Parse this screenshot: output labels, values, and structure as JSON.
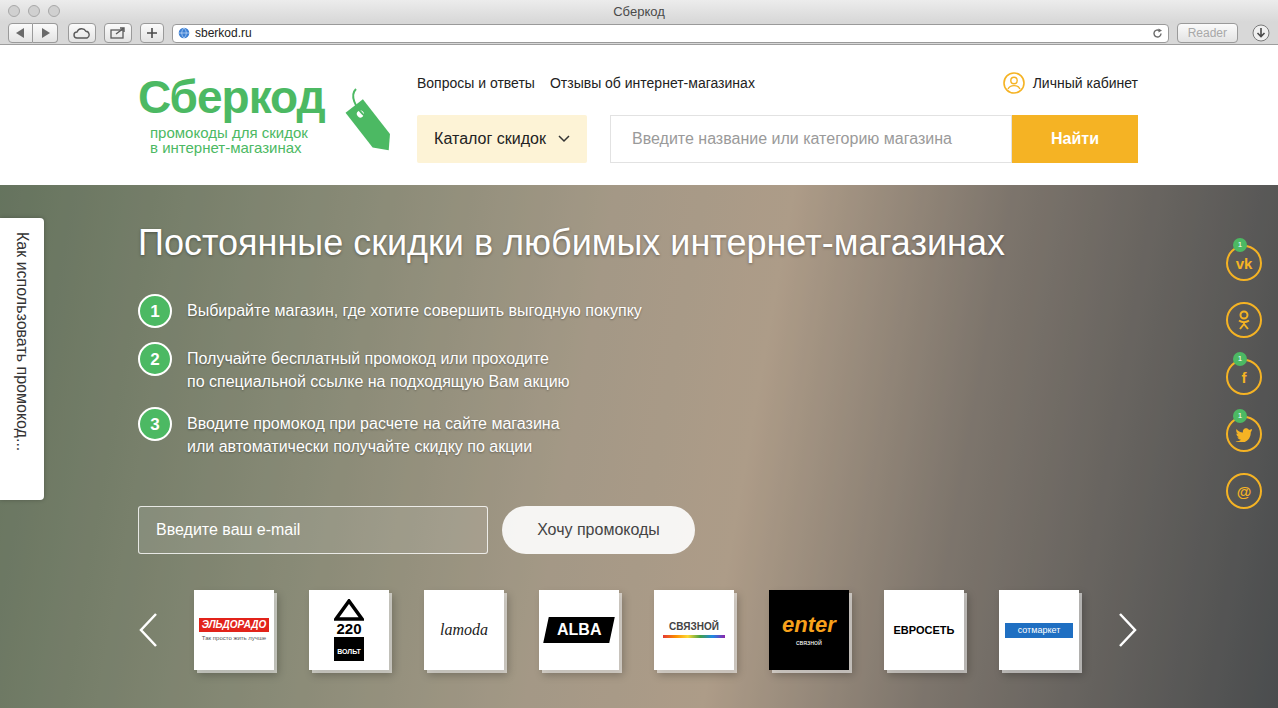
{
  "window": {
    "title": "Сберкод"
  },
  "browser": {
    "url": "sberkod.ru",
    "reader": "Reader"
  },
  "header": {
    "logo": {
      "name": "Сберкод",
      "tagline": [
        "промокоды для скидок",
        "в интернет-магазинах"
      ]
    },
    "nav": [
      "Вопросы и ответы",
      "Отзывы об интернет-магазинах"
    ],
    "account": "Личный кабинет",
    "catalog": "Каталог скидок",
    "search": {
      "placeholder": "Введите название или категорию магазина",
      "button": "Найти"
    }
  },
  "side_tab": "Как использовать промокод...",
  "hero": {
    "title": "Постоянные скидки в любимых интернет-магазинах",
    "steps": [
      {
        "number": "1",
        "lines": [
          "Выбирайте магазин, где хотите совершить выгодную покупку"
        ]
      },
      {
        "number": "2",
        "lines": [
          "Получайте бесплатный промокод или проходите",
          "по специальной ссылке на подходящую Вам акцию"
        ]
      },
      {
        "number": "3",
        "lines": [
          "Вводите промокод при расчете на сайте магазина",
          "или автоматически получайте скидку по акции"
        ]
      }
    ],
    "subscribe": {
      "placeholder": "Введите ваш e-mail",
      "button": "Хочу промокоды"
    }
  },
  "stores": [
    {
      "kind": "eldorado",
      "name": "ЭЛЬДОРАДО",
      "sub": "Так просто жить лучше"
    },
    {
      "kind": "volt",
      "name": "220",
      "sub": "ВОЛЬТ"
    },
    {
      "kind": "lamoda",
      "name": "lamoda"
    },
    {
      "kind": "alba",
      "name": "ALBA"
    },
    {
      "kind": "svyaznoy",
      "name": "СВЯЗНОЙ"
    },
    {
      "kind": "enter",
      "name": "enter",
      "sub": "связной"
    },
    {
      "kind": "euroset",
      "name": "ЕВРОСЕТЬ"
    },
    {
      "kind": "sotmarket",
      "name": "сотмаркет"
    }
  ],
  "social": [
    {
      "kind": "vk",
      "glyph": "vk",
      "badge": "1"
    },
    {
      "kind": "ok"
    },
    {
      "kind": "facebook",
      "glyph": "f",
      "badge": "1"
    },
    {
      "kind": "twitter",
      "badge": "1"
    },
    {
      "kind": "email",
      "glyph": "@"
    }
  ]
}
